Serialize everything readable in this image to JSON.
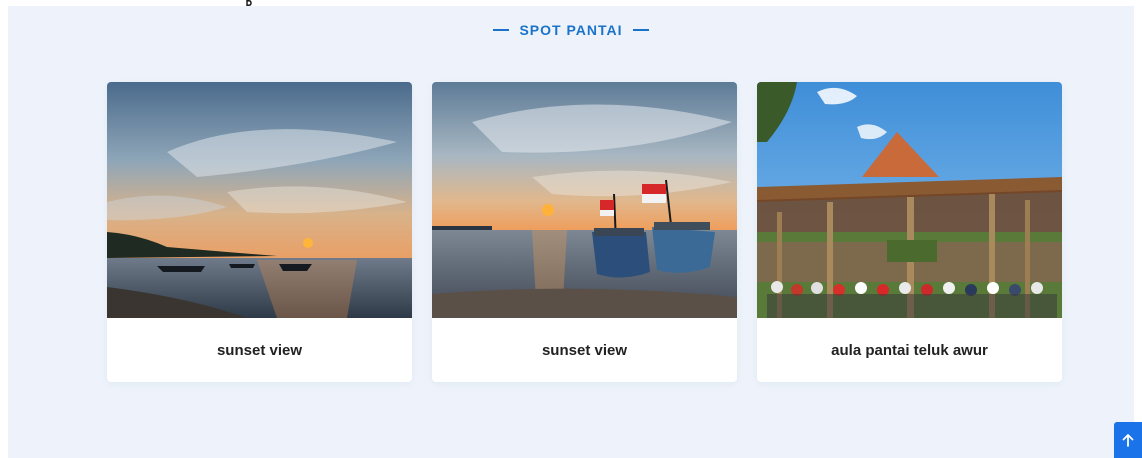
{
  "section": {
    "title": "SPOT PANTAI",
    "accent_color": "#1a73c9",
    "background_color": "#eef3fb"
  },
  "cards": [
    {
      "caption": "sunset view",
      "image": "beach-sunset-boats-photo"
    },
    {
      "caption": "sunset view",
      "image": "beach-sunset-flagged-boats-photo"
    },
    {
      "caption": "aula pantai teluk awur",
      "image": "wooden-pavilion-gathering-photo"
    }
  ],
  "back_to_top": {
    "icon": "arrow-up-icon",
    "color": "#1a73e8"
  }
}
